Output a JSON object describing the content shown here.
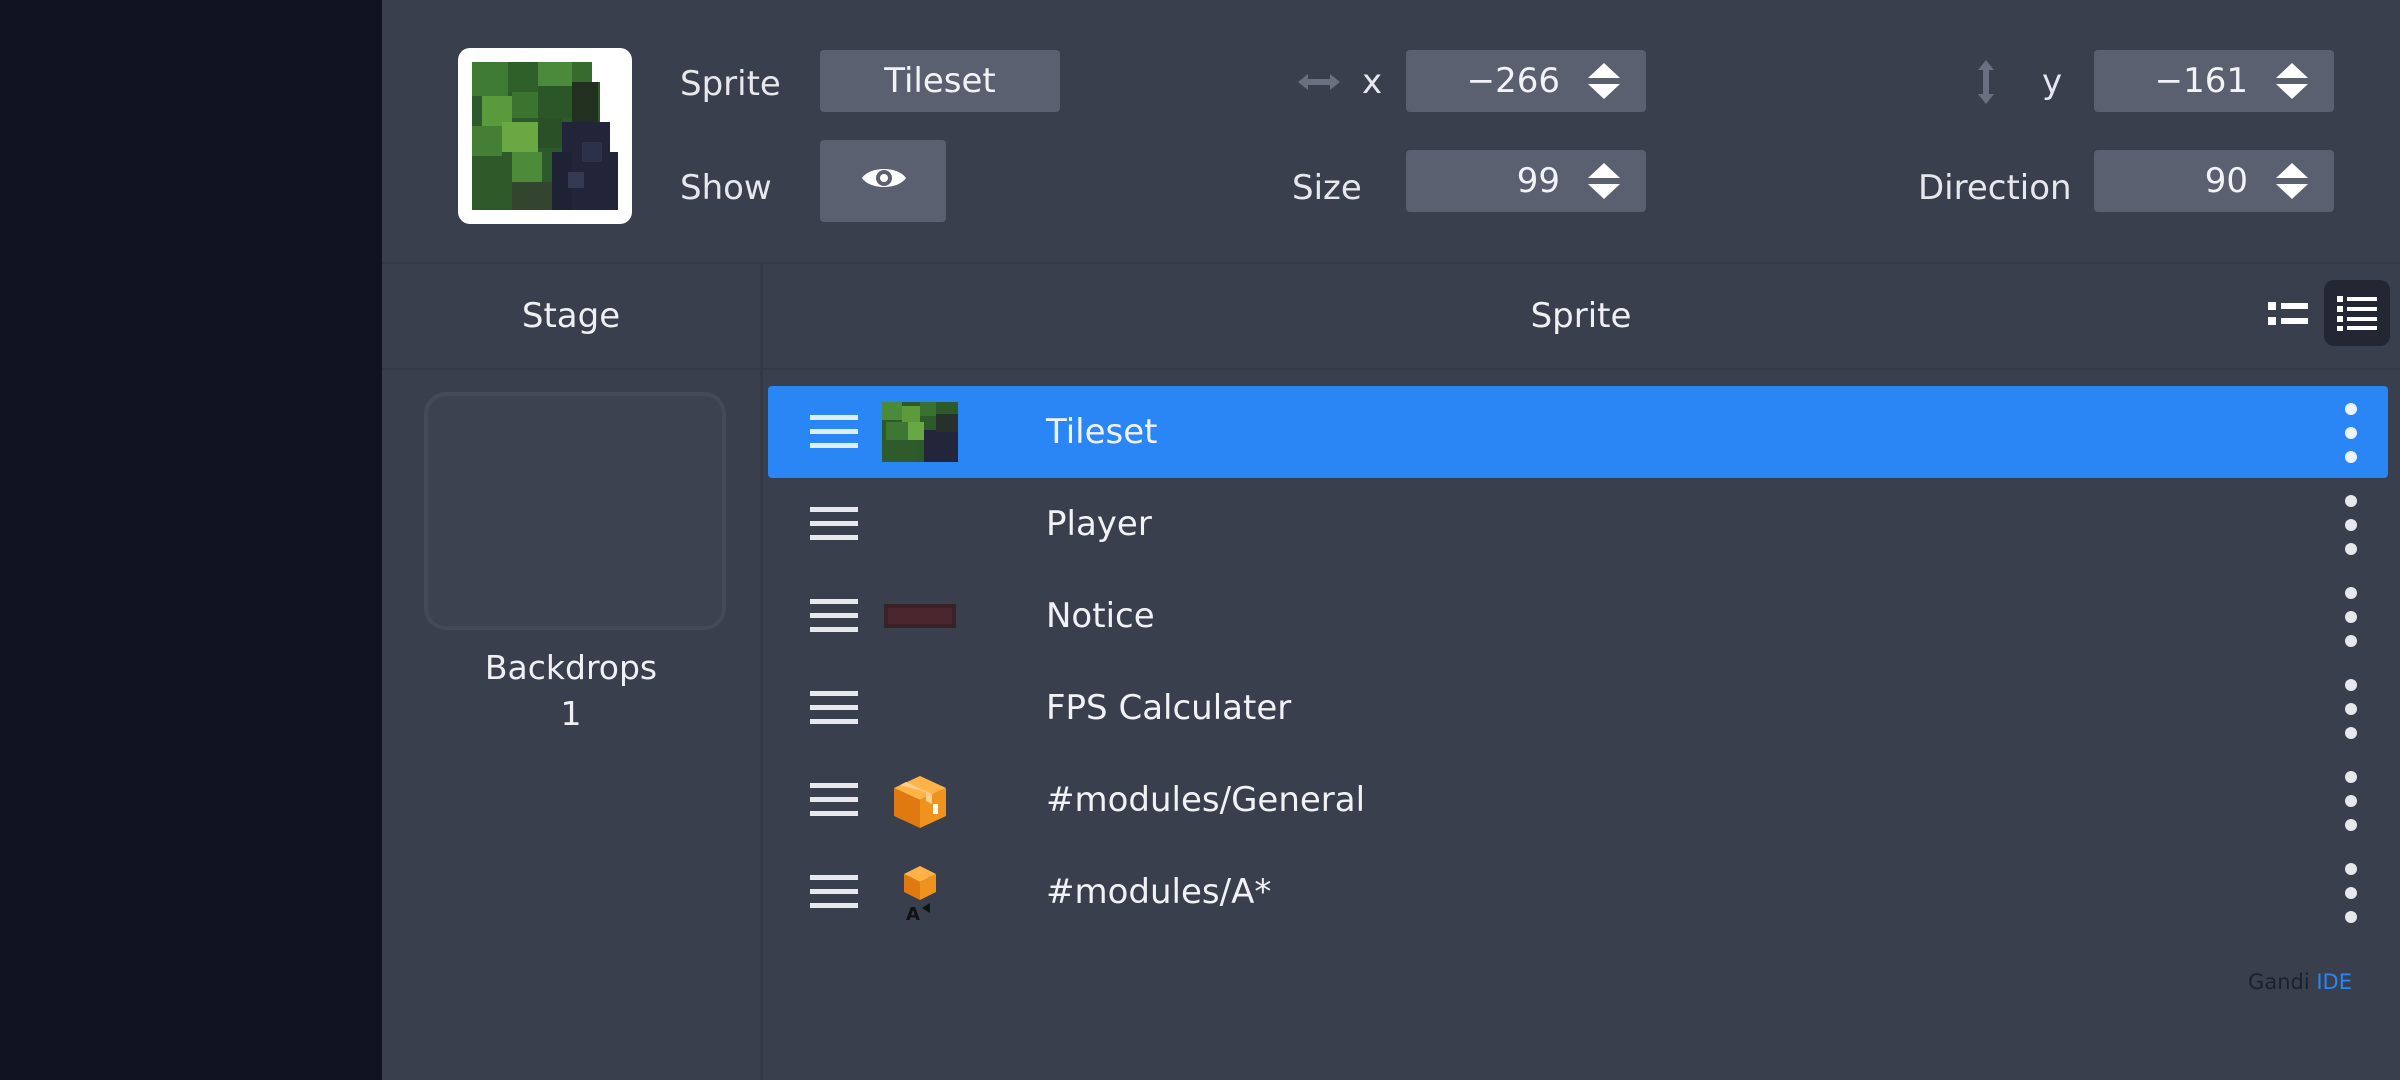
{
  "info": {
    "sprite_label": "Sprite",
    "sprite_name": "Tileset",
    "show_label": "Show",
    "x_label": "x",
    "x_value": "−266",
    "y_label": "y",
    "y_value": "−161",
    "size_label": "Size",
    "size_value": "99",
    "direction_label": "Direction",
    "direction_value": "90"
  },
  "headers": {
    "stage": "Stage",
    "sprite": "Sprite"
  },
  "stage": {
    "backdrops_label": "Backdrops",
    "backdrops_count": "1"
  },
  "sprites": [
    {
      "name": "Tileset",
      "icon": "tileset-thumbnail",
      "selected": true
    },
    {
      "name": "Player",
      "icon": "none",
      "selected": false
    },
    {
      "name": "Notice",
      "icon": "dark-red-bar-thumbnail",
      "selected": false
    },
    {
      "name": "FPS Calculater",
      "icon": "none",
      "selected": false
    },
    {
      "name": "#modules/General",
      "icon": "orange-box-thumbnail",
      "selected": false
    },
    {
      "name": "#modules/A*",
      "icon": "orange-box-a-thumbnail",
      "selected": false
    }
  ],
  "brand": {
    "gandi": "Gandi",
    "ide": "IDE"
  },
  "colors": {
    "accent": "#2a86f5",
    "panel": "#3a3f4d",
    "field": "#5b6070",
    "background": "#0f1420"
  }
}
